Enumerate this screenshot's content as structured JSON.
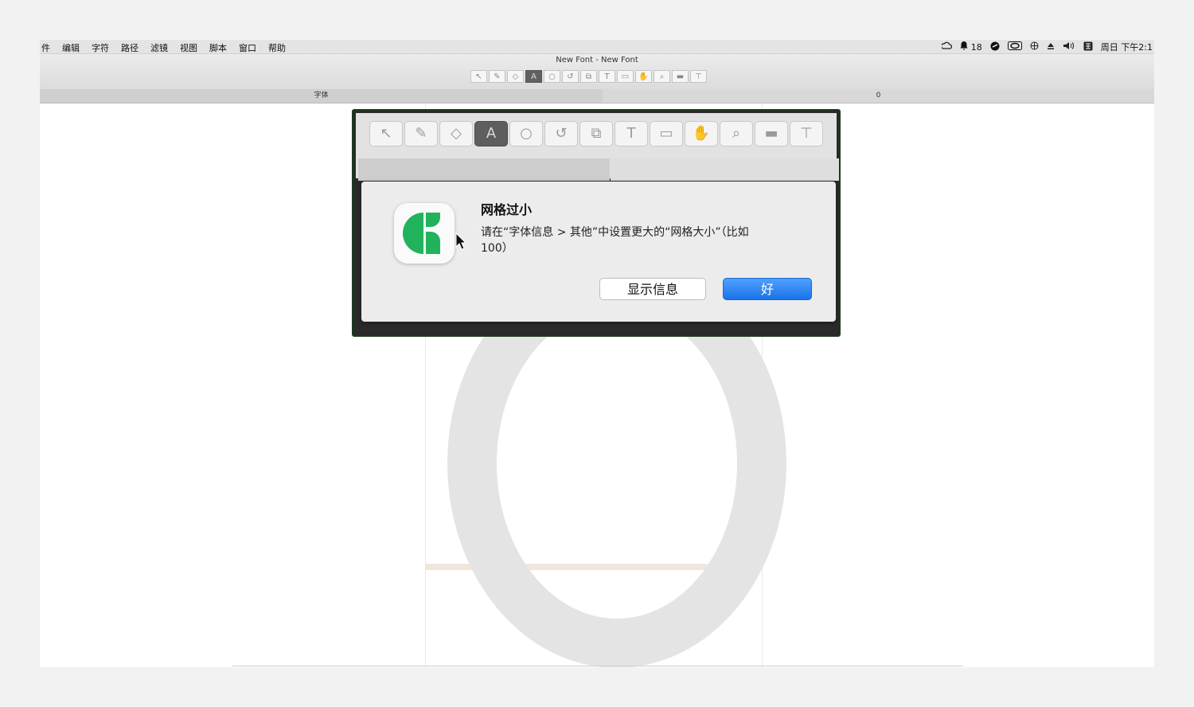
{
  "menubar": {
    "items": [
      "件",
      "编辑",
      "字符",
      "路径",
      "滤镜",
      "视图",
      "脚本",
      "窗口",
      "帮助"
    ],
    "status": {
      "notification_count": "18",
      "clock": "周日 下午2:1"
    }
  },
  "window": {
    "title": "New Font - New Font"
  },
  "tabbar": {
    "left_label": "字体",
    "right_label": "0"
  },
  "toolbar": {
    "tools": [
      "select-icon",
      "pen-icon",
      "eraser-icon",
      "glyph-icon",
      "circle-icon",
      "rotate-icon",
      "scale-icon",
      "text-icon",
      "comment-icon",
      "hand-icon",
      "zoom-icon",
      "ruler-icon",
      "measure-icon"
    ],
    "active_tool": "glyph-icon"
  },
  "dialog": {
    "title": "网格过小",
    "message": "请在“字体信息 > 其他”中设置更大的“网格大小”（比如 100）",
    "show_info_label": "显示信息",
    "ok_label": "好",
    "colors": {
      "ok_button": "#1a73e8",
      "icon_green": "#21b35c"
    }
  }
}
